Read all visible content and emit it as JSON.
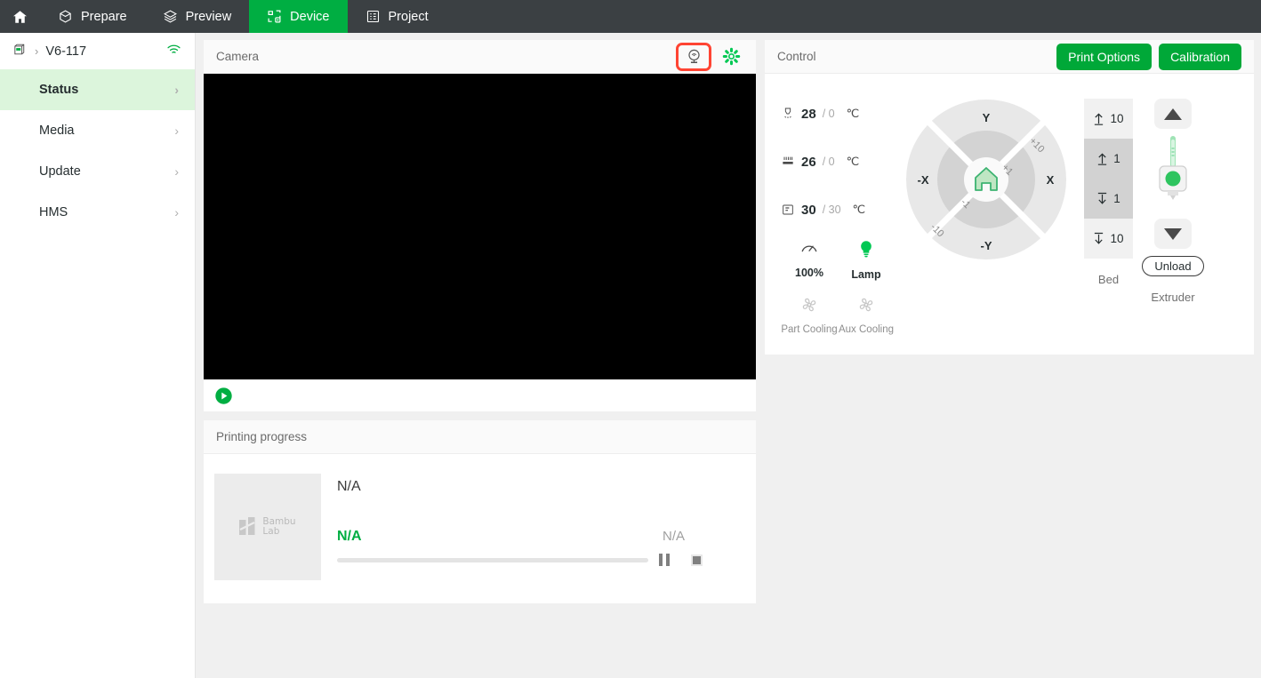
{
  "nav": {
    "home_icon": "home-icon",
    "tabs": [
      {
        "label": "Prepare",
        "icon": "cube-icon",
        "active": false
      },
      {
        "label": "Preview",
        "icon": "layers-icon",
        "active": false
      },
      {
        "label": "Device",
        "icon": "device-icon",
        "active": true
      },
      {
        "label": "Project",
        "icon": "list-icon",
        "active": false
      }
    ]
  },
  "sidebar": {
    "device_icon": "printer-icon",
    "device_separator": "›",
    "device_name": "V6-117",
    "wifi_icon": "wifi-icon",
    "items": [
      {
        "label": "Status",
        "active": true
      },
      {
        "label": "Media",
        "active": false
      },
      {
        "label": "Update",
        "active": false
      },
      {
        "label": "HMS",
        "active": false
      }
    ],
    "chevron": "›"
  },
  "camera": {
    "title": "Camera",
    "webcam_icon": "webcam-icon",
    "settings_icon": "gear-icon",
    "play_icon": "play-icon",
    "webcam_selected": true
  },
  "progress": {
    "title": "Printing progress",
    "thumbnail_logo": "bambu-lab-logo",
    "logo_line1": "Bambu",
    "logo_line2": "Lab",
    "job_name": "N/A",
    "percent_text": "N/A",
    "time_text": "N/A",
    "bar_value": 0,
    "pause_icon": "pause-icon",
    "stop_icon": "stop-icon"
  },
  "control": {
    "title": "Control",
    "print_options_label": "Print Options",
    "calibration_label": "Calibration",
    "accent_color": "#00a838",
    "temps": [
      {
        "icon": "nozzle-icon",
        "current": "28",
        "target": "/ 0",
        "unit": "℃"
      },
      {
        "icon": "bed-icon",
        "current": "26",
        "target": "/ 0",
        "unit": "℃"
      },
      {
        "icon": "chamber-icon",
        "current": "30",
        "target": "/ 30",
        "unit": "℃"
      }
    ],
    "speed": {
      "icon": "speed-gauge-icon",
      "label": "100%"
    },
    "lamp": {
      "icon": "lightbulb-icon",
      "label": "Lamp",
      "on": true
    },
    "fans": [
      {
        "icon": "fan-icon",
        "label": "Part Cooling",
        "on": false
      },
      {
        "icon": "fan-icon",
        "label": "Aux Cooling",
        "on": false
      }
    ],
    "axis": {
      "home_icon": "home-axis-icon",
      "up": "Y",
      "down": "-Y",
      "right": "X",
      "left": "-X",
      "step_outer_pos": "+10",
      "step_inner_pos": "+1",
      "step_inner_neg": "-1",
      "step_outer_neg": "-10"
    },
    "bed": {
      "label": "Bed",
      "steps": [
        {
          "arrow": "up",
          "value": "10"
        },
        {
          "arrow": "up",
          "value": "1"
        },
        {
          "arrow": "down",
          "value": "1"
        },
        {
          "arrow": "down",
          "value": "10"
        }
      ]
    },
    "extruder": {
      "label": "Extruder",
      "up_icon": "triangle-up-icon",
      "down_icon": "triangle-down-icon",
      "nozzle_icon": "extruder-icon",
      "unload_label": "Unload"
    }
  }
}
